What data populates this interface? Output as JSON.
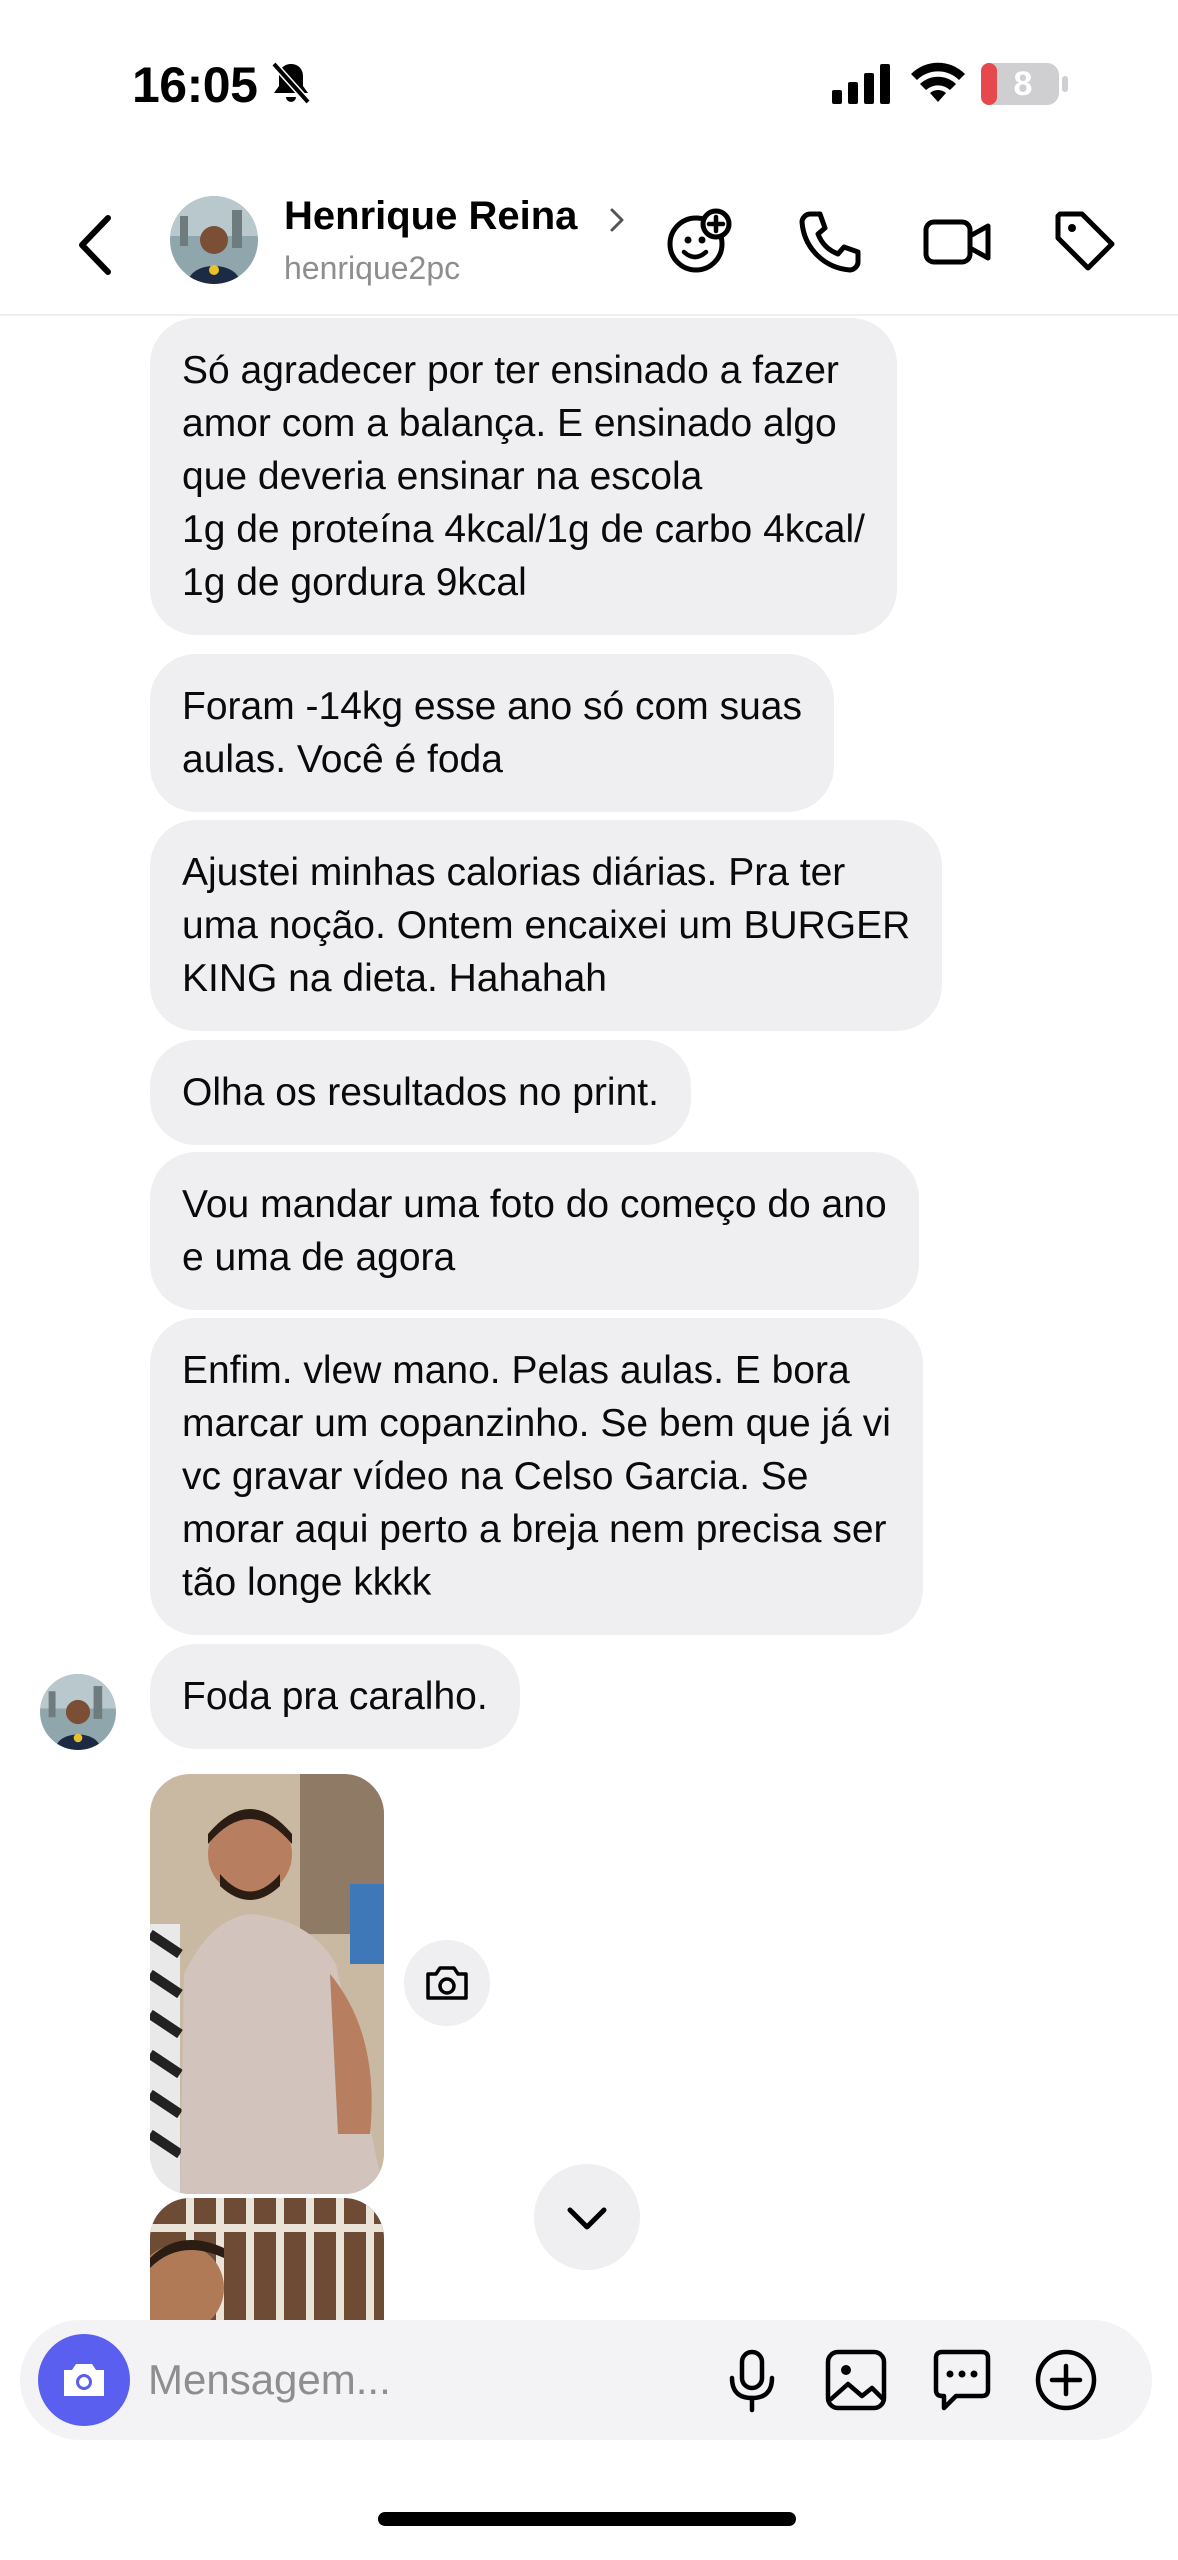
{
  "status_bar": {
    "time": "16:05",
    "battery_level": "8",
    "icons": [
      "bell-slash-icon",
      "signal-icon",
      "wifi-icon",
      "battery-icon"
    ]
  },
  "header": {
    "contact_name": "Henrique Reina",
    "username": "henrique2pc",
    "icons": [
      "back-arrow-icon",
      "chevron-right-icon",
      "effects-icon",
      "phone-icon",
      "video-icon",
      "tag-icon"
    ]
  },
  "messages": [
    {
      "text": "Só agradecer por ter ensinado a fazer\namor com a balança. E ensinado algo\nque deveria ensinar na escola\n1g de proteína 4kcal/1g de carbo 4kcal/\n1g de gordura 9kcal"
    },
    {
      "text": "Foram -14kg esse ano só com suas\naulas. Você é foda"
    },
    {
      "text": "Ajustei minhas calorias diárias. Pra ter\numa noção. Ontem encaixei um BURGER\nKING na dieta. Hahahah"
    },
    {
      "text": "Olha os resultados no print."
    },
    {
      "text": "Vou mandar uma foto do começo do ano\ne uma de agora"
    },
    {
      "text": "Enfim. vlew mano. Pelas aulas. E bora\nmarcar um copanzinho. Se bem que já vi\nvc gravar vídeo na Celso Garcia. Se\nmorar aqui perto a breja nem precisa ser\ntão longe kkkk"
    },
    {
      "text": "Foda pra caralho."
    }
  ],
  "composer": {
    "placeholder": "Mensagem...",
    "icons": [
      "camera-icon",
      "microphone-icon",
      "gallery-icon",
      "sticker-icon",
      "plus-icon"
    ]
  },
  "colors": {
    "bubble": "#efeff1",
    "accent": "#5b5ff0",
    "battery_low": "#e5484d",
    "muted_text": "#8e8e8e"
  }
}
